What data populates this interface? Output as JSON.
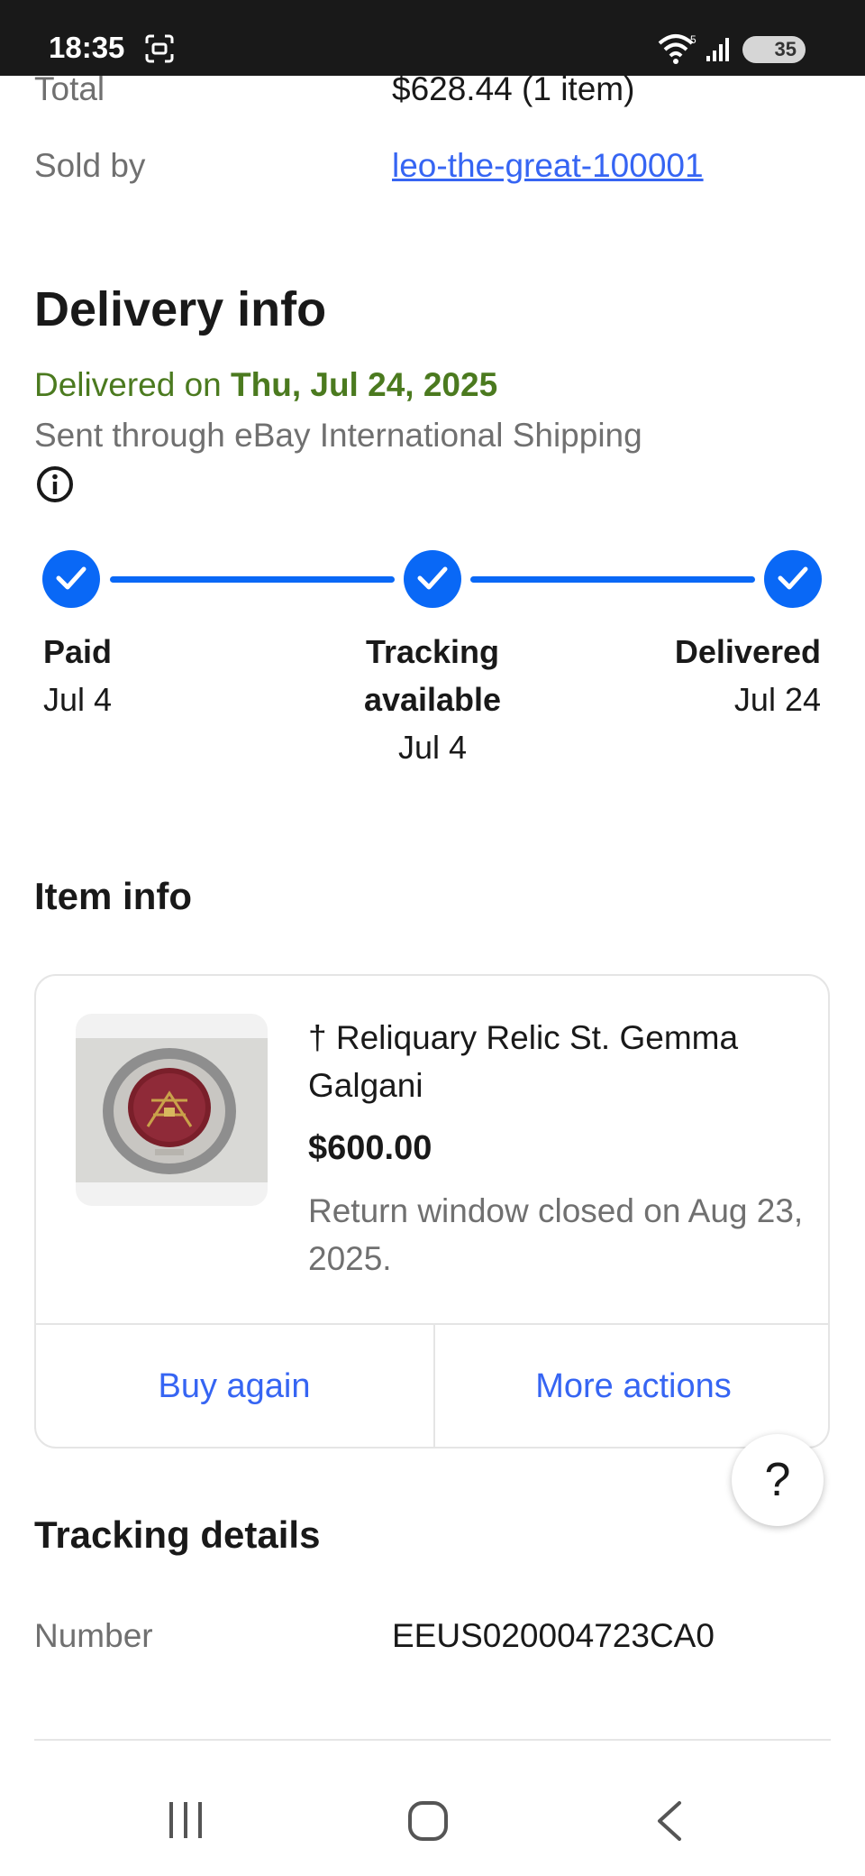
{
  "status_bar": {
    "time": "18:35",
    "battery": "35"
  },
  "summary": {
    "total_label": "Total",
    "total_value": "$628.44 (1 item)",
    "sold_by_label": "Sold by",
    "seller": "leo-the-great-100001"
  },
  "delivery": {
    "title": "Delivery info",
    "delivered_prefix": "Delivered on ",
    "delivered_date": "Thu, Jul 24, 2025",
    "shipping_method": "Sent through eBay International Shipping",
    "steps": [
      {
        "label": "Paid",
        "date": "Jul 4"
      },
      {
        "label_line1": "Tracking",
        "label_line2": "available",
        "date": "Jul 4"
      },
      {
        "label": "Delivered",
        "date": "Jul 24"
      }
    ]
  },
  "item_info": {
    "title": "Item info",
    "item_title": "† Reliquary Relic St. Gemma Galgani",
    "price": "$600.00",
    "return_note": "Return window closed on Aug 23, 2025.",
    "buy_again": "Buy again",
    "more_actions": "More actions"
  },
  "help_button": "?",
  "tracking": {
    "title": "Tracking details",
    "number_label": "Number",
    "number_value": "EEUS020004723CA0"
  },
  "colors": {
    "accent_blue": "#0968f6",
    "link_blue": "#3665f3",
    "success_green": "#4b7a1f"
  }
}
